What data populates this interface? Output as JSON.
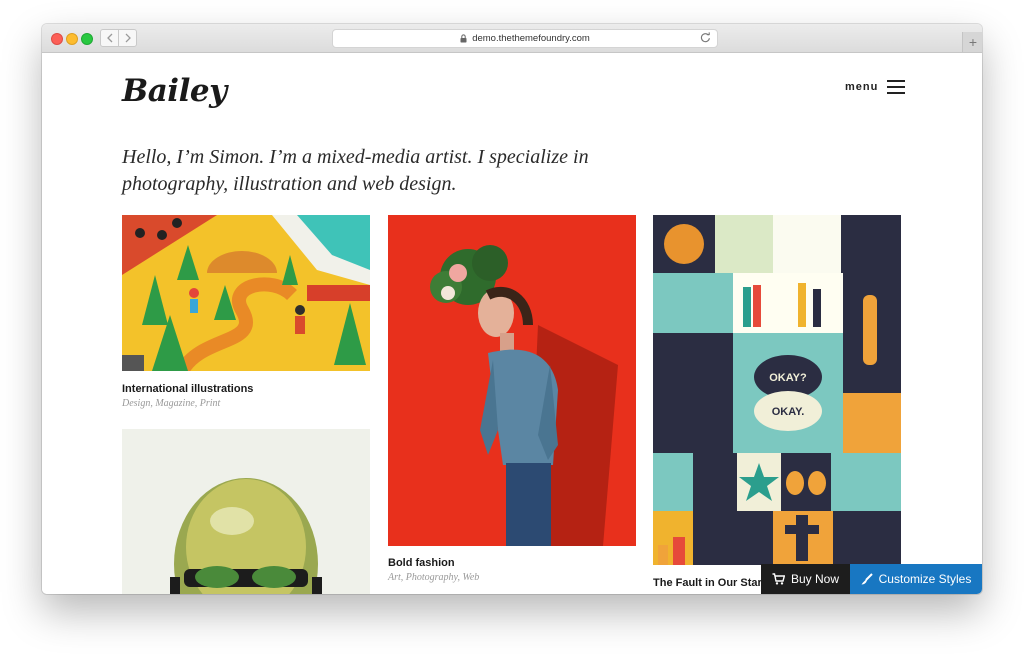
{
  "browser": {
    "url": "demo.thethemefoundry.com",
    "new_tab": "+"
  },
  "site": {
    "logo": "Bailey",
    "menu_label": "menu",
    "intro": "Hello, I’m Simon. I’m a mixed-media artist. I specialize in photography, illustration and web design."
  },
  "portfolio": [
    {
      "title": "International illustrations",
      "tags": "Design, Magazine, Print"
    },
    {
      "title": "Bold fashion",
      "tags": "Art, Photography, Web"
    },
    {
      "title": "The Fault in Our Stars",
      "tags": ""
    }
  ],
  "actions": {
    "buy_label": "Buy Now",
    "customize_label": "Customize Styles"
  },
  "colors": {
    "accent_blue": "#1877c2",
    "dark_button": "#1d1d1d",
    "fashion_red": "#e8301c"
  }
}
